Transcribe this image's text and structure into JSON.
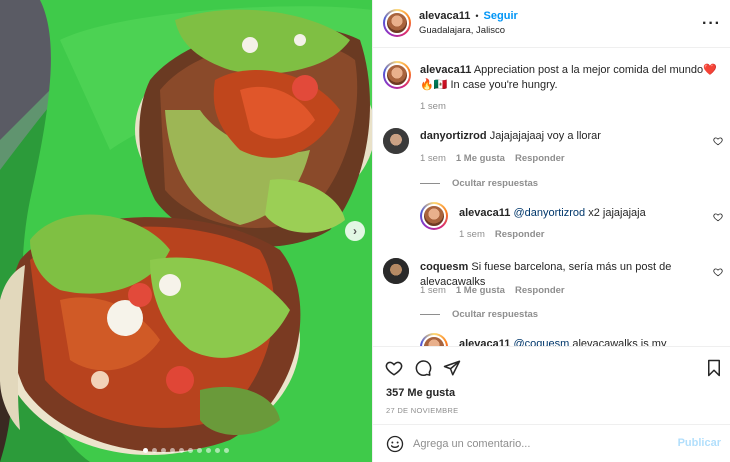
{
  "post": {
    "author": "alevaca11",
    "follow_label": "Seguir",
    "separator": "•",
    "location": "Guadalajara, Jalisco",
    "more_icon": "more-horizontal-icon"
  },
  "caption": {
    "username": "alevaca11",
    "text": "Appreciation post a la mejor comida del mundo❤️🔥🇲🇽 In case you're hungry.",
    "time": "1 sem"
  },
  "comments": [
    {
      "username": "danyortizrod",
      "text": "Jajajajajaaj voy a llorar",
      "time": "1 sem",
      "likes": "1 Me gusta",
      "reply": "Responder",
      "hide_replies": "Ocultar respuestas",
      "replies": [
        {
          "username": "alevaca11",
          "mention": "@danyortizrod",
          "text": " x2 jajajajaja",
          "time": "1 sem",
          "reply": "Responder"
        }
      ]
    },
    {
      "username": "coquesm",
      "text": "Si fuese barcelona, sería más un post de alevacawalks",
      "time": "1 sem",
      "likes": "1 Me gusta",
      "reply": "Responder",
      "hide_replies": "Ocultar respuestas",
      "replies": [
        {
          "username": "alevaca11",
          "mention": "@coquesm",
          "text": " alevacawalks is my"
        }
      ]
    }
  ],
  "actions": {
    "like_icon": "heart-icon",
    "comment_icon": "comment-icon",
    "share_icon": "paper-plane-icon",
    "save_icon": "bookmark-icon"
  },
  "likes_count": "357 Me gusta",
  "date": "27 DE NOVIEMBRE",
  "add_comment": {
    "placeholder": "Agrega un comentario...",
    "publish_label": "Publicar",
    "emoji_icon": "emoji-icon"
  },
  "carousel": {
    "next_icon": "chevron-right-icon",
    "slide_count": 10,
    "active_index": 0
  },
  "colors": {
    "accent": "#0095f6",
    "accent_disabled": "#b2dffc",
    "text": "#262626",
    "muted": "#8e8e8e",
    "plate": "#2b9d3a"
  }
}
